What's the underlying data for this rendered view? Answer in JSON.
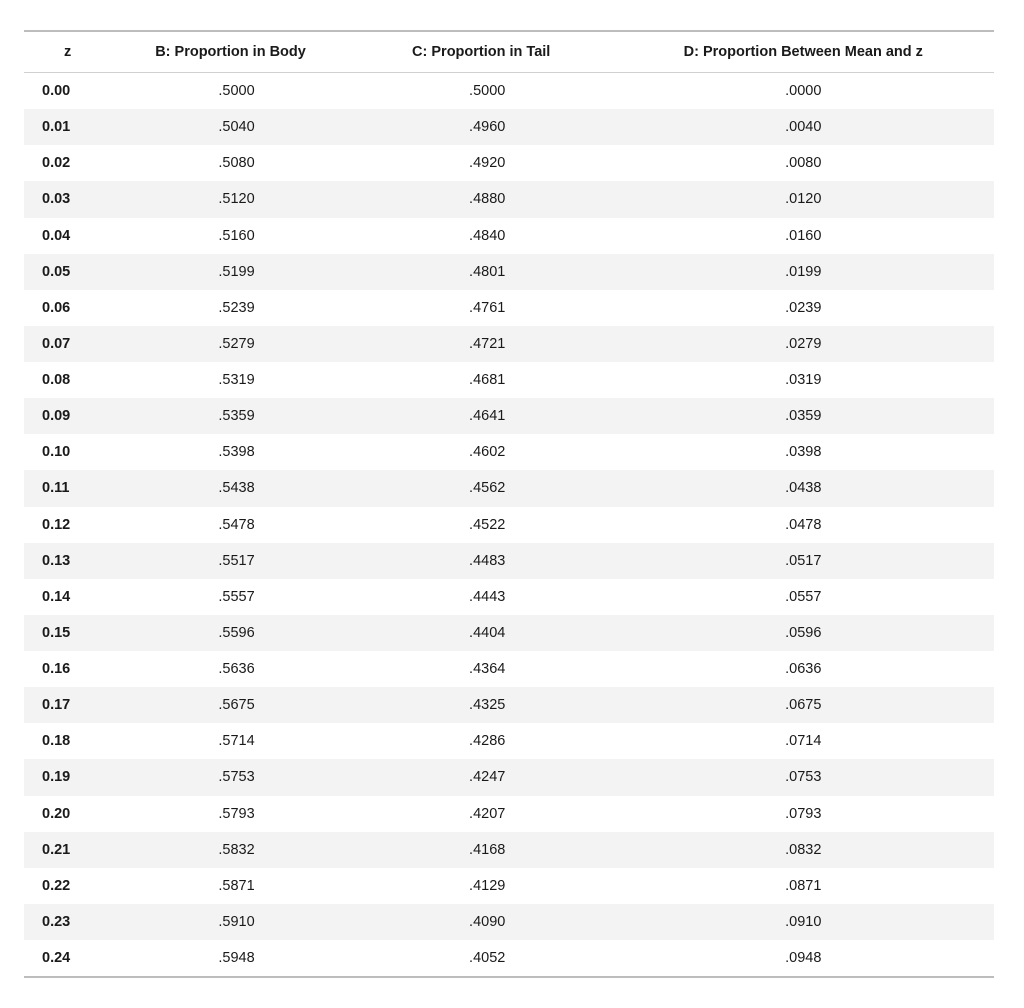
{
  "headers": {
    "z": "z",
    "b": "B: Proportion in Body",
    "c": "C: Proportion in Tail",
    "d": "D: Proportion Between Mean and z"
  },
  "rows": [
    {
      "z": "0.00",
      "b": ".5000",
      "c": ".5000",
      "d": ".0000"
    },
    {
      "z": "0.01",
      "b": ".5040",
      "c": ".4960",
      "d": ".0040"
    },
    {
      "z": "0.02",
      "b": ".5080",
      "c": ".4920",
      "d": ".0080"
    },
    {
      "z": "0.03",
      "b": ".5120",
      "c": ".4880",
      "d": ".0120"
    },
    {
      "z": "0.04",
      "b": ".5160",
      "c": ".4840",
      "d": ".0160"
    },
    {
      "z": "0.05",
      "b": ".5199",
      "c": ".4801",
      "d": ".0199"
    },
    {
      "z": "0.06",
      "b": ".5239",
      "c": ".4761",
      "d": ".0239"
    },
    {
      "z": "0.07",
      "b": ".5279",
      "c": ".4721",
      "d": ".0279"
    },
    {
      "z": "0.08",
      "b": ".5319",
      "c": ".4681",
      "d": ".0319"
    },
    {
      "z": "0.09",
      "b": ".5359",
      "c": ".4641",
      "d": ".0359"
    },
    {
      "z": "0.10",
      "b": ".5398",
      "c": ".4602",
      "d": ".0398"
    },
    {
      "z": "0.11",
      "b": ".5438",
      "c": ".4562",
      "d": ".0438"
    },
    {
      "z": "0.12",
      "b": ".5478",
      "c": ".4522",
      "d": ".0478"
    },
    {
      "z": "0.13",
      "b": ".5517",
      "c": ".4483",
      "d": ".0517"
    },
    {
      "z": "0.14",
      "b": ".5557",
      "c": ".4443",
      "d": ".0557"
    },
    {
      "z": "0.15",
      "b": ".5596",
      "c": ".4404",
      "d": ".0596"
    },
    {
      "z": "0.16",
      "b": ".5636",
      "c": ".4364",
      "d": ".0636"
    },
    {
      "z": "0.17",
      "b": ".5675",
      "c": ".4325",
      "d": ".0675"
    },
    {
      "z": "0.18",
      "b": ".5714",
      "c": ".4286",
      "d": ".0714"
    },
    {
      "z": "0.19",
      "b": ".5753",
      "c": ".4247",
      "d": ".0753"
    },
    {
      "z": "0.20",
      "b": ".5793",
      "c": ".4207",
      "d": ".0793"
    },
    {
      "z": "0.21",
      "b": ".5832",
      "c": ".4168",
      "d": ".0832"
    },
    {
      "z": "0.22",
      "b": ".5871",
      "c": ".4129",
      "d": ".0871"
    },
    {
      "z": "0.23",
      "b": ".5910",
      "c": ".4090",
      "d": ".0910"
    },
    {
      "z": "0.24",
      "b": ".5948",
      "c": ".4052",
      "d": ".0948"
    }
  ]
}
